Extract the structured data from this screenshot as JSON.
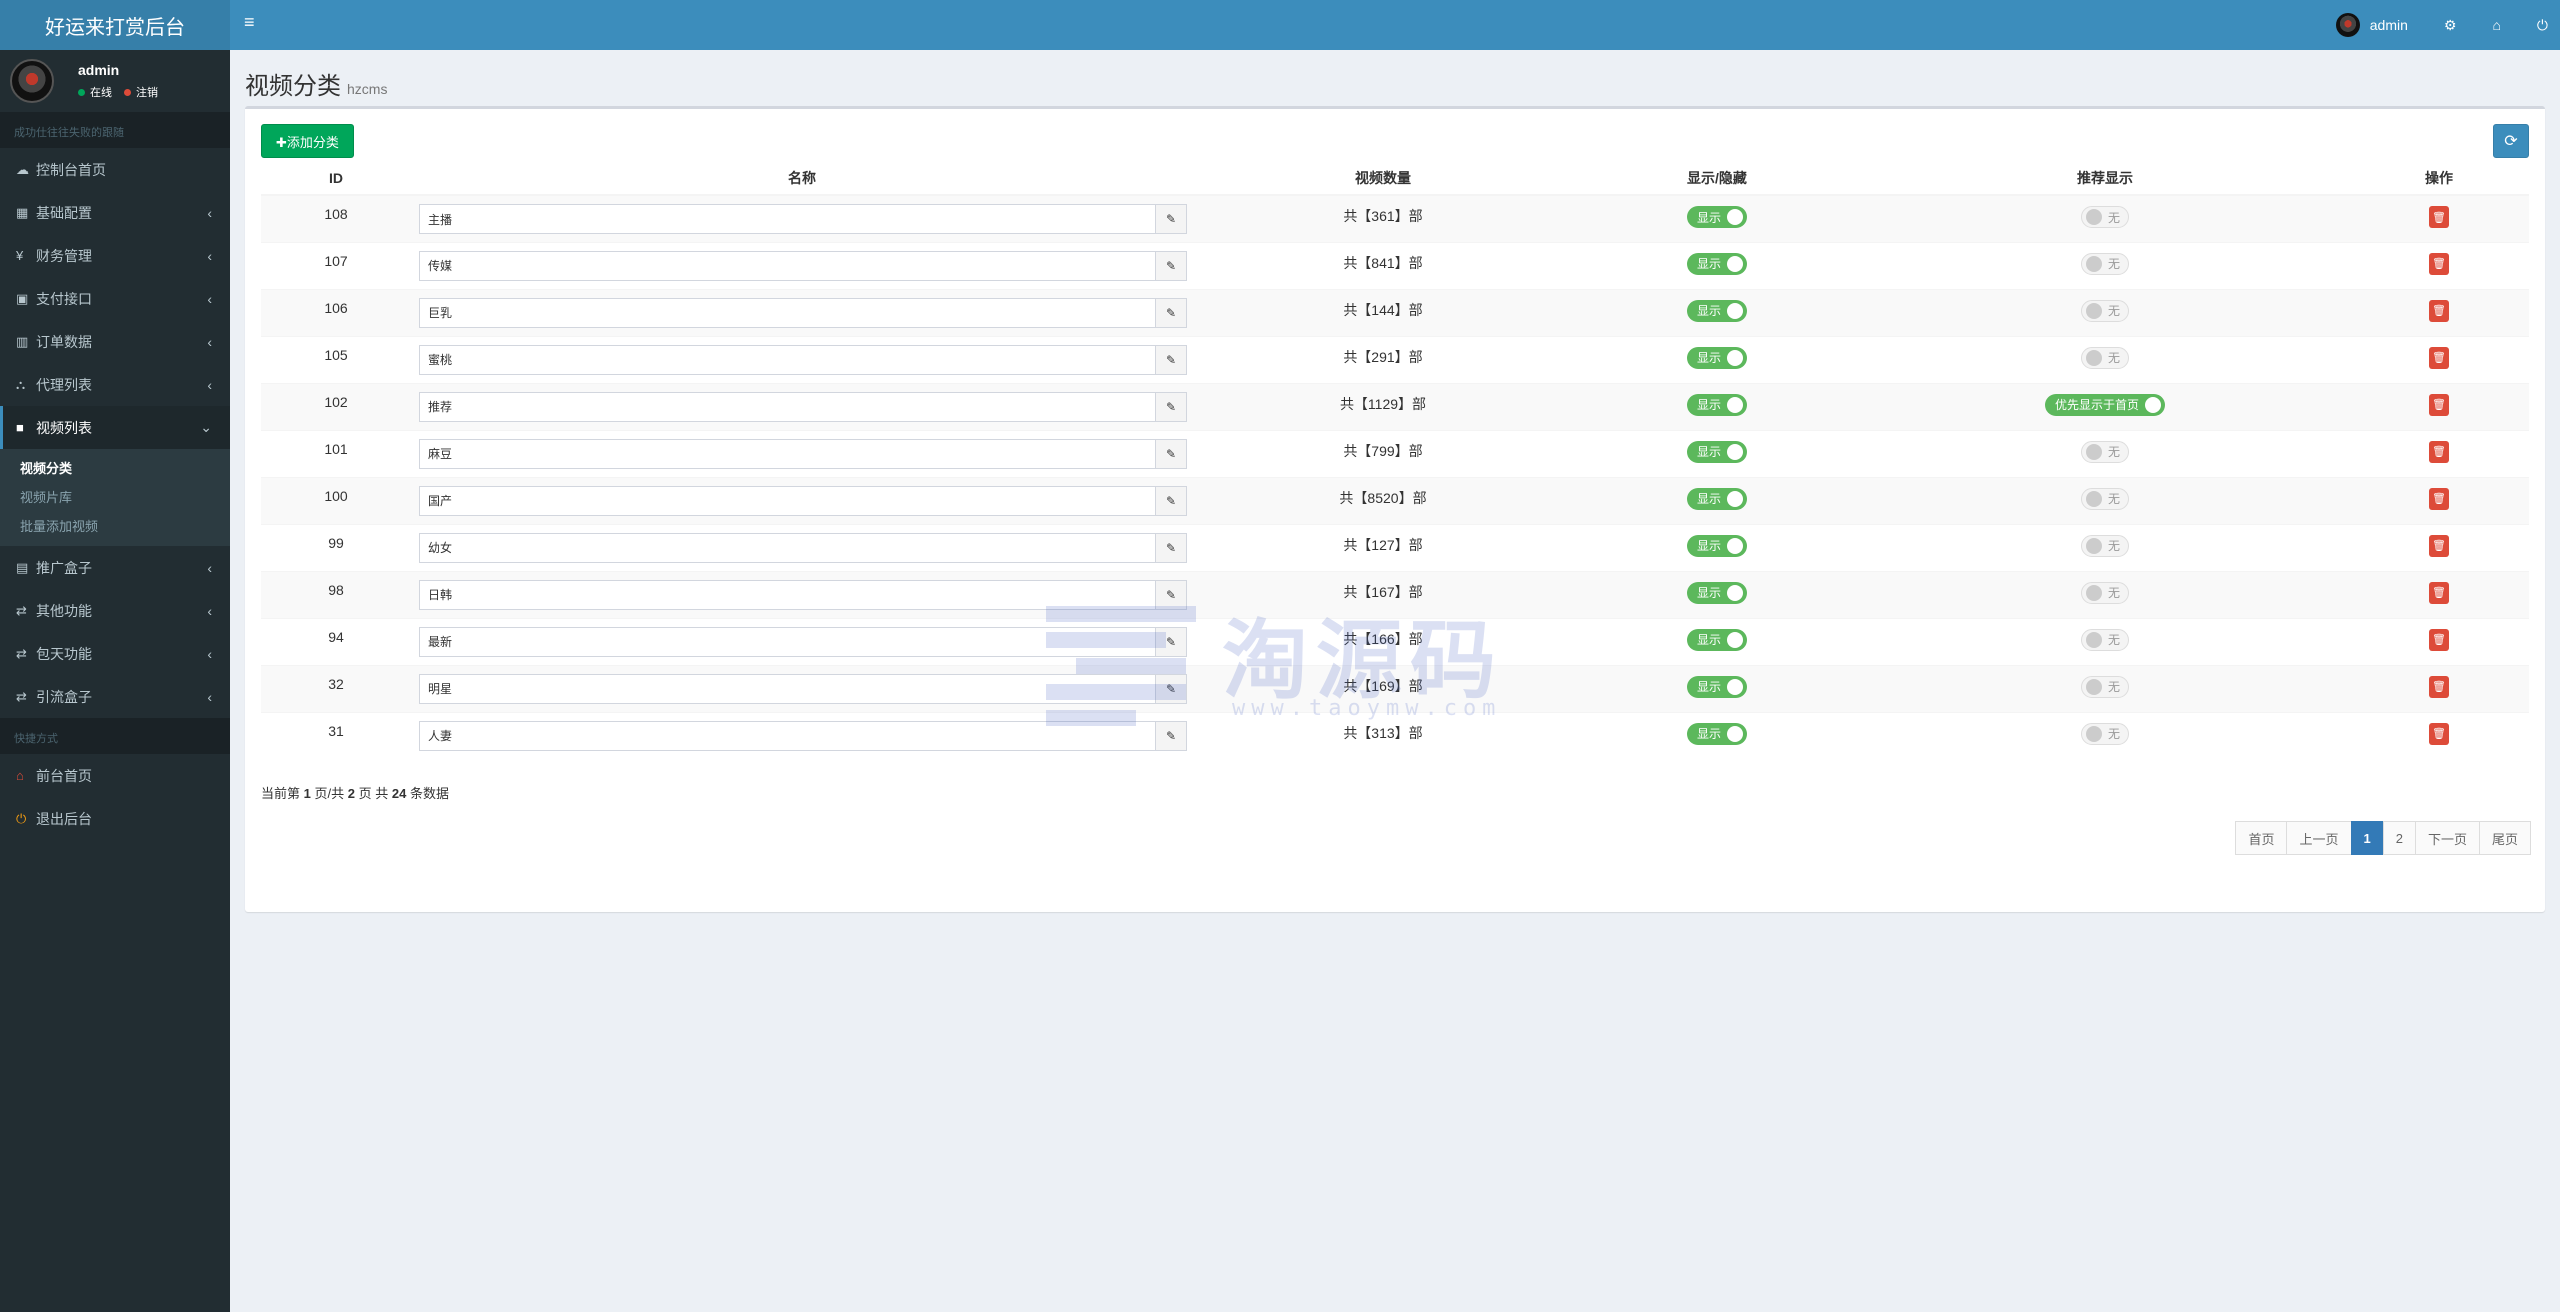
{
  "app": {
    "title": "好运来打赏后台"
  },
  "user": {
    "name": "admin",
    "status_online": "在线",
    "status_logout": "注销"
  },
  "sidebar": {
    "search_placeholder": "成功仕往往失败的跟随",
    "items": [
      {
        "label": "控制台首页",
        "icon": "dashboard-icon",
        "glyph": "☁",
        "has_caret": false
      },
      {
        "label": "基础配置",
        "icon": "grid-icon",
        "glyph": "▦",
        "has_caret": true
      },
      {
        "label": "财务管理",
        "icon": "yen-icon",
        "glyph": "¥",
        "has_caret": true
      },
      {
        "label": "支付接口",
        "icon": "payment-icon",
        "glyph": "▣",
        "has_caret": true
      },
      {
        "label": "订单数据",
        "icon": "bar-chart-icon",
        "glyph": "▥",
        "has_caret": true
      },
      {
        "label": "代理列表",
        "icon": "sitemap-icon",
        "glyph": "⛬",
        "has_caret": true
      }
    ],
    "active_item": {
      "label": "视频列表",
      "icon": "video-icon",
      "glyph": "■"
    },
    "submenu": [
      {
        "label": "视频分类",
        "active": true
      },
      {
        "label": "视频片库",
        "active": false
      },
      {
        "label": "批量添加视频",
        "active": false
      }
    ],
    "items_after": [
      {
        "label": "推广盒子",
        "icon": "table-icon",
        "glyph": "▤",
        "has_caret": true
      },
      {
        "label": "其他功能",
        "icon": "retweet-icon",
        "glyph": "⇄",
        "has_caret": true
      },
      {
        "label": "包天功能",
        "icon": "retweet-icon",
        "glyph": "⇄",
        "has_caret": true
      },
      {
        "label": "引流盒子",
        "icon": "retweet-icon",
        "glyph": "⇄",
        "has_caret": true
      }
    ],
    "section_label": "快捷方式",
    "shortcuts": [
      {
        "label": "前台首页",
        "icon": "home-icon",
        "glyph": "⌂",
        "color": "#dd4b39"
      },
      {
        "label": "退出后台",
        "icon": "power-icon",
        "glyph": "⏻",
        "color": "#f39c12"
      }
    ]
  },
  "header": {
    "menu_toggle_glyph": "≡",
    "user_label": "admin"
  },
  "page": {
    "title": "视频分类",
    "subtitle": "hzcms"
  },
  "toolbar": {
    "add_label": "✚添加分类",
    "refresh_glyph": "⟳"
  },
  "table": {
    "columns": [
      "ID",
      "名称",
      "视频数量",
      "显示/隐藏",
      "推荐显示",
      "操作"
    ],
    "rows": [
      {
        "id": "108",
        "name": "主播",
        "count": "共【361】部",
        "show": "显示",
        "rec": "无",
        "rec_on": false
      },
      {
        "id": "107",
        "name": "传媒",
        "count": "共【841】部",
        "show": "显示",
        "rec": "无",
        "rec_on": false
      },
      {
        "id": "106",
        "name": "巨乳",
        "count": "共【144】部",
        "show": "显示",
        "rec": "无",
        "rec_on": false
      },
      {
        "id": "105",
        "name": "蜜桃",
        "count": "共【291】部",
        "show": "显示",
        "rec": "无",
        "rec_on": false
      },
      {
        "id": "102",
        "name": "推荐",
        "count": "共【1129】部",
        "show": "显示",
        "rec": "优先显示于首页",
        "rec_on": true
      },
      {
        "id": "101",
        "name": "麻豆",
        "count": "共【799】部",
        "show": "显示",
        "rec": "无",
        "rec_on": false
      },
      {
        "id": "100",
        "name": "国产",
        "count": "共【8520】部",
        "show": "显示",
        "rec": "无",
        "rec_on": false
      },
      {
        "id": "99",
        "name": "幼女",
        "count": "共【127】部",
        "show": "显示",
        "rec": "无",
        "rec_on": false
      },
      {
        "id": "98",
        "name": "日韩",
        "count": "共【167】部",
        "show": "显示",
        "rec": "无",
        "rec_on": false
      },
      {
        "id": "94",
        "name": "最新",
        "count": "共【166】部",
        "show": "显示",
        "rec": "无",
        "rec_on": false
      },
      {
        "id": "32",
        "name": "明星",
        "count": "共【169】部",
        "show": "显示",
        "rec": "无",
        "rec_on": false
      },
      {
        "id": "31",
        "name": "人妻",
        "count": "共【313】部",
        "show": "显示",
        "rec": "无",
        "rec_on": false
      }
    ]
  },
  "pagination": {
    "info_prefix": "当前第",
    "current": "1",
    "info_mid": "页/共",
    "total_pages": "2",
    "info_mid2": "页 共",
    "total_items": "24",
    "info_suffix": "条数据",
    "buttons": [
      "首页",
      "上一页",
      "1",
      "2",
      "下一页",
      "尾页"
    ],
    "active": "1"
  },
  "watermark": {
    "text": "淘源码",
    "url": "www.taoymw.com"
  }
}
